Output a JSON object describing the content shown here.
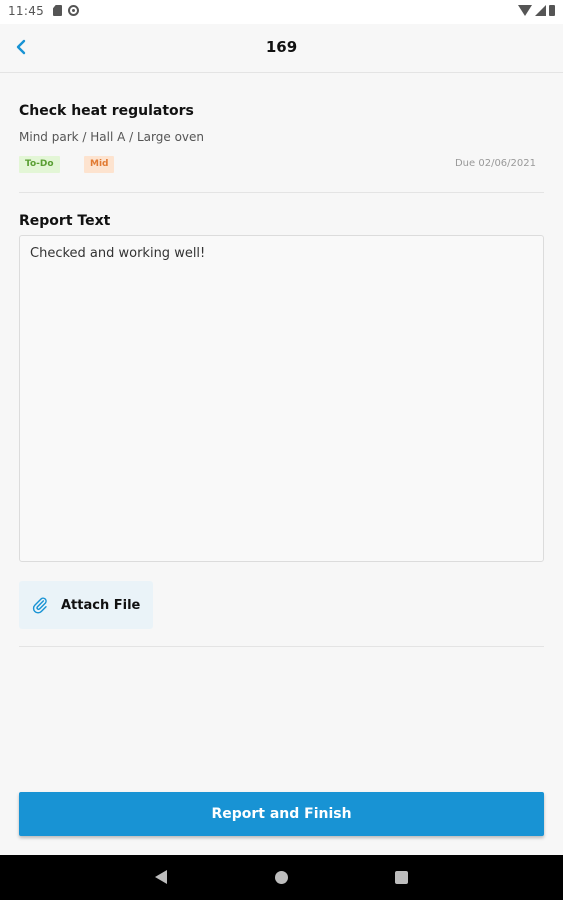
{
  "status_bar": {
    "time": "11:45",
    "left_icons": [
      "sd-card-icon",
      "at-sign-icon"
    ],
    "right_icons": [
      "wifi-icon",
      "signal-icon",
      "battery-icon"
    ]
  },
  "app_bar": {
    "title": "169",
    "back_icon": "chevron-left-icon"
  },
  "task": {
    "title": "Check heat regulators",
    "path": "Mind park / Hall A / Large oven",
    "status_badge": "To-Do",
    "priority_badge": "Mid",
    "due": "Due 02/06/2021"
  },
  "report": {
    "label": "Report Text",
    "value": "Checked and working well!"
  },
  "attach": {
    "label": "Attach File",
    "icon": "paperclip-icon"
  },
  "primary_action": {
    "label": "Report and Finish"
  },
  "colors": {
    "accent": "#1893d4",
    "todo_bg": "#e3f6d6",
    "todo_text": "#5a9f33",
    "mid_bg": "#fde3cf",
    "mid_text": "#e17a32",
    "attach_bg": "#eaf3f8"
  },
  "nav_bar": {
    "buttons": [
      "back-triangle-icon",
      "home-circle-icon",
      "recents-square-icon"
    ]
  }
}
